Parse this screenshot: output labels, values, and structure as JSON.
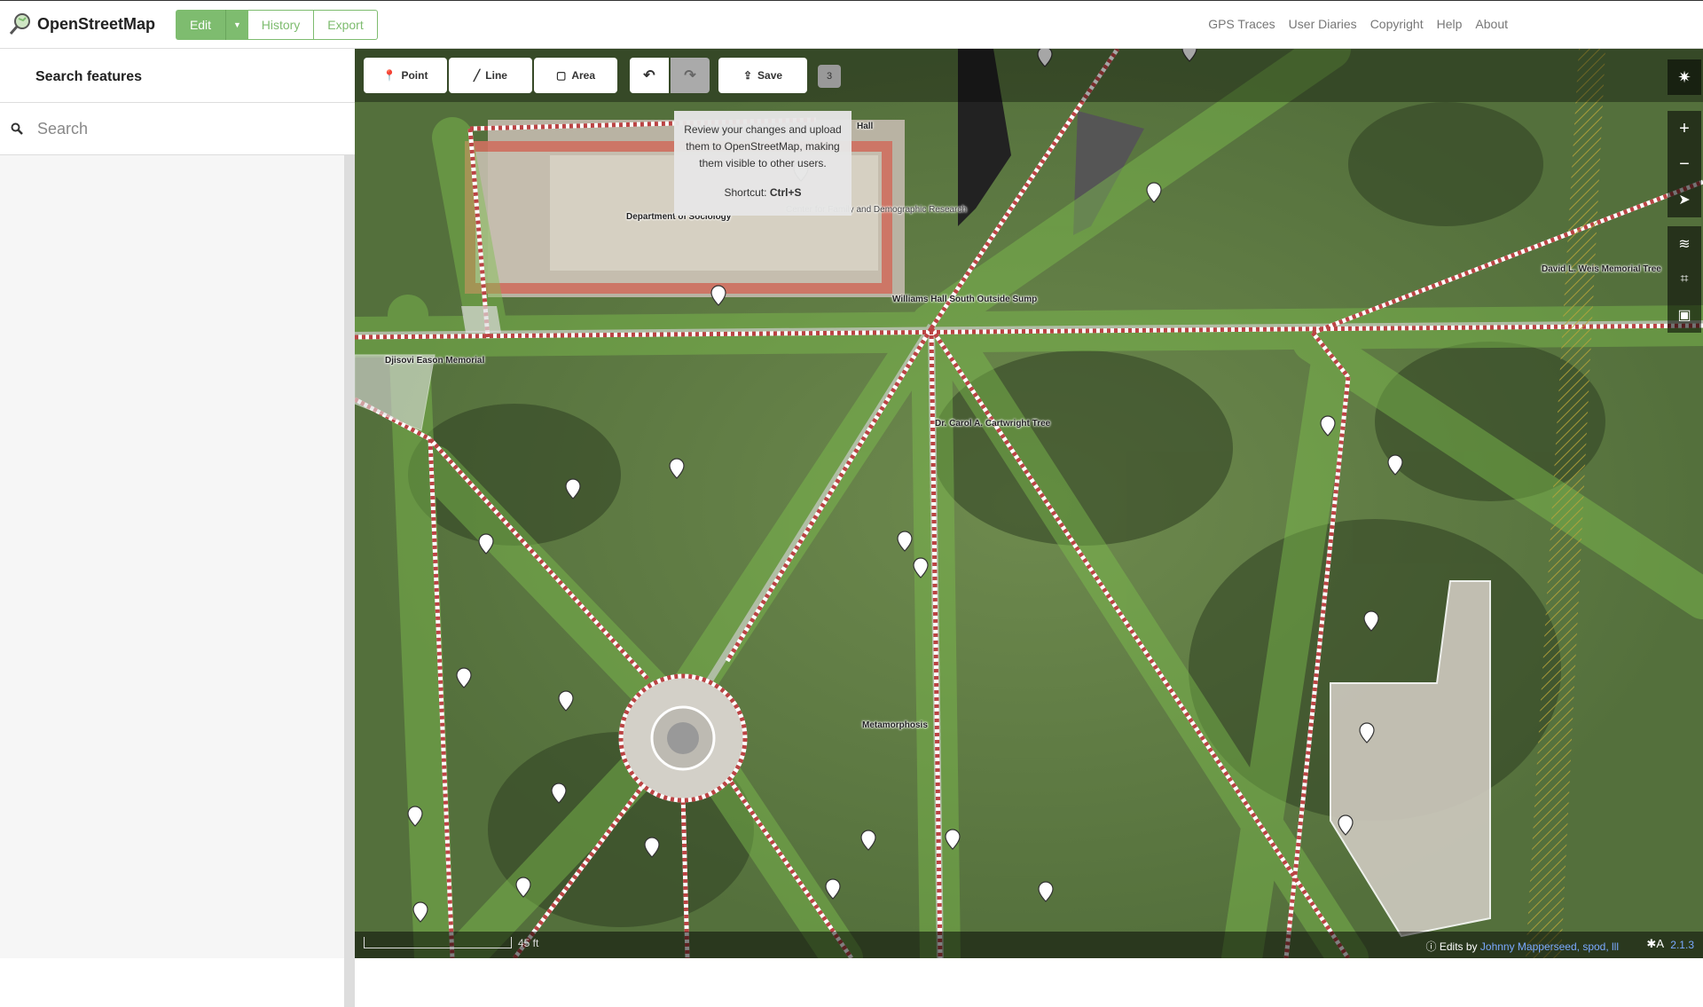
{
  "header": {
    "site_name": "OpenStreetMap",
    "edit_label": "Edit",
    "history_label": "History",
    "export_label": "Export",
    "links": [
      "GPS Traces",
      "User Diaries",
      "Copyright",
      "Help",
      "About"
    ]
  },
  "sidebar": {
    "title": "Search features",
    "search_placeholder": "Search"
  },
  "toolbar": {
    "point_label": "Point",
    "line_label": "Line",
    "area_label": "Area",
    "save_label": "Save",
    "edit_count": "3"
  },
  "tooltip": {
    "text": "Review your changes and upload them to OpenStreetMap, making them visible to other users.",
    "shortcut_label": "Shortcut:",
    "shortcut_key": "Ctrl+S"
  },
  "map_labels": {
    "hall": "Hall",
    "dept_sociology": "Department of Sociology",
    "family_research": "Center for Family and Demographic Research",
    "sump": "Williams Hall South Outside Sump",
    "memorial": "Djisovi Eason Memorial",
    "cartwright": "Dr. Carol A. Cartwright Tree",
    "weis": "David L. Weis Memorial Tree",
    "metamorphosis": "Metamorphosis"
  },
  "footer": {
    "scale": "45 ft",
    "edits_by_label": "Edits by",
    "edits_by_users": "Johnny Mapperseed, spod, lll",
    "version": "2.1.3"
  },
  "colors": {
    "brand_green": "#7ebc6f",
    "link_blue": "#7aa9ff"
  }
}
